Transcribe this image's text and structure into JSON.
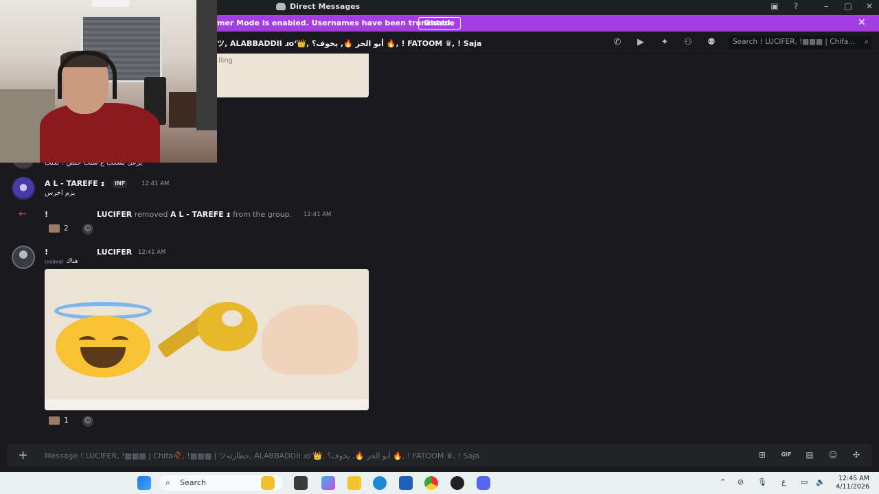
{
  "window": {
    "title": "Direct Messages"
  },
  "banner": {
    "text": "mer Mode is enabled. Usernames have been truncated.",
    "button": "Disable",
    "color": "#a33ee6"
  },
  "header": {
    "title": "ツ, ALABBADDII ɹoʻ👑, أبو الحز 🔥, يخوف؟ 🔥, ! FATOOM ♛, ! Saja",
    "search_placeholder": "Search ! LUCIFER, !▩▩▩ | Chifa..."
  },
  "top_image": {
    "caption": "iling"
  },
  "messages": {
    "m1": {
      "text": "يزعل بشكب ع شنت حلص ! تكتب"
    },
    "m2": {
      "name": "A L - TAREFE ɪ",
      "badge": "INF",
      "time": "12:41 AM",
      "text": "يزم اخرس"
    },
    "m3": {
      "actor_prefix": "!",
      "actor": "LUCIFER",
      "action": "removed",
      "target": "A L - TAREFE ɪ",
      "suffix": "from the group.",
      "time": "12:41 AM",
      "reaction_count": "2"
    },
    "m4": {
      "name_prefix": "!",
      "name": "LUCIFER",
      "time": "12:41 AM",
      "edited": "(edited)",
      "text": "هناك",
      "reaction_count": "1"
    }
  },
  "composer": {
    "placeholder": "Message ! LUCIFER, !▩▩▩ | Chifa🥀, !▩▩▩ | ツحظارته, ALABBADDII ɹoʻ👑, أبو الحز 🔥, يخوف؟ 🔥, ! FATOOM ♛, ! Saja"
  },
  "taskbar": {
    "search_label": "Search",
    "lang": "ع",
    "time": "12:45 AM",
    "date": "4/11/2026"
  }
}
